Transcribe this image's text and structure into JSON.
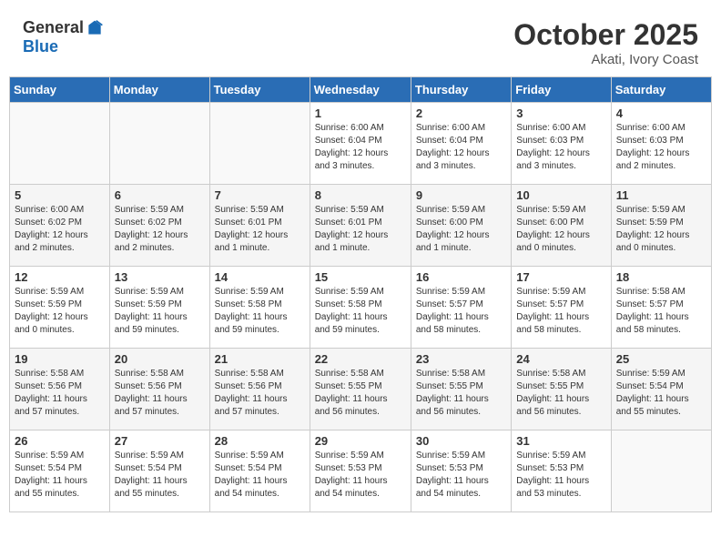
{
  "header": {
    "logo_general": "General",
    "logo_blue": "Blue",
    "month_title": "October 2025",
    "subtitle": "Akati, Ivory Coast"
  },
  "weekdays": [
    "Sunday",
    "Monday",
    "Tuesday",
    "Wednesday",
    "Thursday",
    "Friday",
    "Saturday"
  ],
  "weeks": [
    {
      "days": [
        {
          "num": "",
          "info": ""
        },
        {
          "num": "",
          "info": ""
        },
        {
          "num": "",
          "info": ""
        },
        {
          "num": "1",
          "info": "Sunrise: 6:00 AM\nSunset: 6:04 PM\nDaylight: 12 hours\nand 3 minutes."
        },
        {
          "num": "2",
          "info": "Sunrise: 6:00 AM\nSunset: 6:04 PM\nDaylight: 12 hours\nand 3 minutes."
        },
        {
          "num": "3",
          "info": "Sunrise: 6:00 AM\nSunset: 6:03 PM\nDaylight: 12 hours\nand 3 minutes."
        },
        {
          "num": "4",
          "info": "Sunrise: 6:00 AM\nSunset: 6:03 PM\nDaylight: 12 hours\nand 2 minutes."
        }
      ]
    },
    {
      "days": [
        {
          "num": "5",
          "info": "Sunrise: 6:00 AM\nSunset: 6:02 PM\nDaylight: 12 hours\nand 2 minutes."
        },
        {
          "num": "6",
          "info": "Sunrise: 5:59 AM\nSunset: 6:02 PM\nDaylight: 12 hours\nand 2 minutes."
        },
        {
          "num": "7",
          "info": "Sunrise: 5:59 AM\nSunset: 6:01 PM\nDaylight: 12 hours\nand 1 minute."
        },
        {
          "num": "8",
          "info": "Sunrise: 5:59 AM\nSunset: 6:01 PM\nDaylight: 12 hours\nand 1 minute."
        },
        {
          "num": "9",
          "info": "Sunrise: 5:59 AM\nSunset: 6:00 PM\nDaylight: 12 hours\nand 1 minute."
        },
        {
          "num": "10",
          "info": "Sunrise: 5:59 AM\nSunset: 6:00 PM\nDaylight: 12 hours\nand 0 minutes."
        },
        {
          "num": "11",
          "info": "Sunrise: 5:59 AM\nSunset: 5:59 PM\nDaylight: 12 hours\nand 0 minutes."
        }
      ]
    },
    {
      "days": [
        {
          "num": "12",
          "info": "Sunrise: 5:59 AM\nSunset: 5:59 PM\nDaylight: 12 hours\nand 0 minutes."
        },
        {
          "num": "13",
          "info": "Sunrise: 5:59 AM\nSunset: 5:59 PM\nDaylight: 11 hours\nand 59 minutes."
        },
        {
          "num": "14",
          "info": "Sunrise: 5:59 AM\nSunset: 5:58 PM\nDaylight: 11 hours\nand 59 minutes."
        },
        {
          "num": "15",
          "info": "Sunrise: 5:59 AM\nSunset: 5:58 PM\nDaylight: 11 hours\nand 59 minutes."
        },
        {
          "num": "16",
          "info": "Sunrise: 5:59 AM\nSunset: 5:57 PM\nDaylight: 11 hours\nand 58 minutes."
        },
        {
          "num": "17",
          "info": "Sunrise: 5:59 AM\nSunset: 5:57 PM\nDaylight: 11 hours\nand 58 minutes."
        },
        {
          "num": "18",
          "info": "Sunrise: 5:58 AM\nSunset: 5:57 PM\nDaylight: 11 hours\nand 58 minutes."
        }
      ]
    },
    {
      "days": [
        {
          "num": "19",
          "info": "Sunrise: 5:58 AM\nSunset: 5:56 PM\nDaylight: 11 hours\nand 57 minutes."
        },
        {
          "num": "20",
          "info": "Sunrise: 5:58 AM\nSunset: 5:56 PM\nDaylight: 11 hours\nand 57 minutes."
        },
        {
          "num": "21",
          "info": "Sunrise: 5:58 AM\nSunset: 5:56 PM\nDaylight: 11 hours\nand 57 minutes."
        },
        {
          "num": "22",
          "info": "Sunrise: 5:58 AM\nSunset: 5:55 PM\nDaylight: 11 hours\nand 56 minutes."
        },
        {
          "num": "23",
          "info": "Sunrise: 5:58 AM\nSunset: 5:55 PM\nDaylight: 11 hours\nand 56 minutes."
        },
        {
          "num": "24",
          "info": "Sunrise: 5:58 AM\nSunset: 5:55 PM\nDaylight: 11 hours\nand 56 minutes."
        },
        {
          "num": "25",
          "info": "Sunrise: 5:59 AM\nSunset: 5:54 PM\nDaylight: 11 hours\nand 55 minutes."
        }
      ]
    },
    {
      "days": [
        {
          "num": "26",
          "info": "Sunrise: 5:59 AM\nSunset: 5:54 PM\nDaylight: 11 hours\nand 55 minutes."
        },
        {
          "num": "27",
          "info": "Sunrise: 5:59 AM\nSunset: 5:54 PM\nDaylight: 11 hours\nand 55 minutes."
        },
        {
          "num": "28",
          "info": "Sunrise: 5:59 AM\nSunset: 5:54 PM\nDaylight: 11 hours\nand 54 minutes."
        },
        {
          "num": "29",
          "info": "Sunrise: 5:59 AM\nSunset: 5:53 PM\nDaylight: 11 hours\nand 54 minutes."
        },
        {
          "num": "30",
          "info": "Sunrise: 5:59 AM\nSunset: 5:53 PM\nDaylight: 11 hours\nand 54 minutes."
        },
        {
          "num": "31",
          "info": "Sunrise: 5:59 AM\nSunset: 5:53 PM\nDaylight: 11 hours\nand 53 minutes."
        },
        {
          "num": "",
          "info": ""
        }
      ]
    }
  ]
}
